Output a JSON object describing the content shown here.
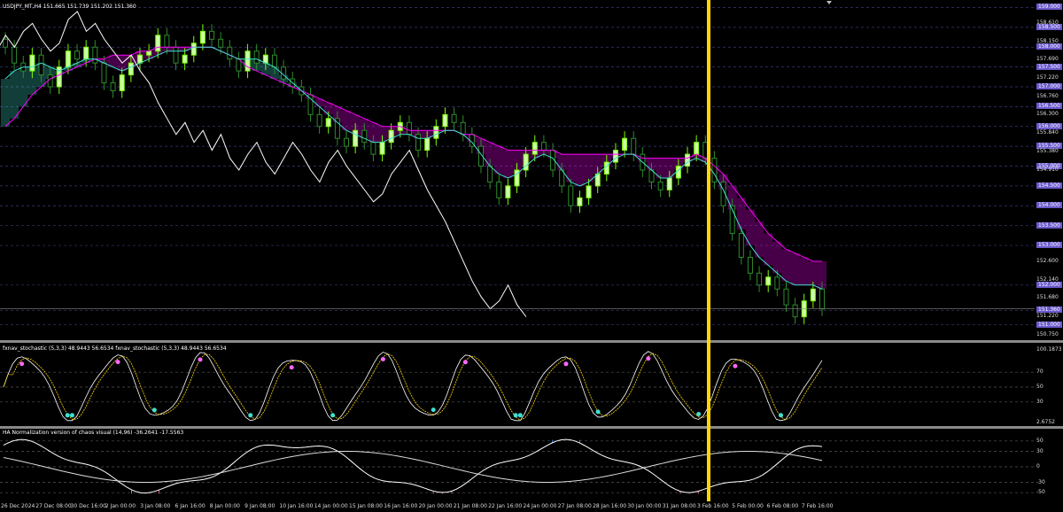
{
  "main": {
    "header": "USDJPY_MT,H4  151.665 151.739 151.202 151.360",
    "price_axis": [
      {
        "text": "159.000",
        "boxed": true
      },
      {
        "text": "158.610",
        "boxed": false
      },
      {
        "text": "158.500",
        "boxed": true
      },
      {
        "text": "158.150",
        "boxed": false
      },
      {
        "text": "158.000",
        "boxed": true
      },
      {
        "text": "157.690",
        "boxed": false
      },
      {
        "text": "157.500",
        "boxed": true
      },
      {
        "text": "157.220",
        "boxed": false
      },
      {
        "text": "157.000",
        "boxed": true
      },
      {
        "text": "156.760",
        "boxed": false
      },
      {
        "text": "156.500",
        "boxed": true
      },
      {
        "text": "156.300",
        "boxed": false
      },
      {
        "text": "156.000",
        "boxed": true
      },
      {
        "text": "155.840",
        "boxed": false
      },
      {
        "text": "155.500",
        "boxed": true
      },
      {
        "text": "155.380",
        "boxed": false
      },
      {
        "text": "155.000",
        "boxed": true
      },
      {
        "text": "154.910",
        "boxed": false
      },
      {
        "text": "154.500",
        "boxed": true
      },
      {
        "text": "154.000",
        "boxed": true
      },
      {
        "text": "153.500",
        "boxed": true
      },
      {
        "text": "153.000",
        "boxed": true
      },
      {
        "text": "152.600",
        "boxed": false
      },
      {
        "text": "152.140",
        "boxed": false
      },
      {
        "text": "152.000",
        "boxed": true
      },
      {
        "text": "151.680",
        "boxed": false
      },
      {
        "text": "151.360",
        "boxed": true
      },
      {
        "text": "151.220",
        "boxed": false
      },
      {
        "text": "151.000",
        "boxed": true
      },
      {
        "text": "150.750",
        "boxed": false
      }
    ]
  },
  "stoch": {
    "header": "fxnav_stochastic (5,3,3) 48.9443 56.6534  fxnav_stochastic (5,3,3) 48.9443 56.6534",
    "axis": [
      "100.1873",
      "70",
      "50",
      "30",
      "2.6752"
    ]
  },
  "osc": {
    "header": "HA Normalization version of chaos visual (14,96) -36.2641 -17.5563",
    "axis": [
      "50",
      "30",
      "0",
      "-30",
      "-50"
    ]
  },
  "time_axis": [
    "26 Dec 2024",
    "27 Dec 08:00",
    "30 Dec 16:00",
    "2 Jan 00:00",
    "3 Jan 08:00",
    "6 Jan 16:00",
    "8 Jan 00:00",
    "9 Jan 08:00",
    "10 Jan 16:00",
    "14 Jan 00:00",
    "15 Jan 08:00",
    "16 Jan 16:00",
    "20 Jan 00:00",
    "21 Jan 08:00",
    "22 Jan 16:00",
    "24 Jan 00:00",
    "27 Jan 08:00",
    "28 Jan 16:00",
    "30 Jan 00:00",
    "31 Jan 08:00",
    "3 Feb 16:00",
    "5 Feb 00:00",
    "6 Feb 08:00",
    "7 Feb 16:00"
  ],
  "colors": {
    "bull": "#7CFC00",
    "bear": "#2e8b2e",
    "kumo_bull": "#40e0d0",
    "kumo_bear": "#ff00ff",
    "kijun": "#ff00ff",
    "tenkan": "#40e0d0",
    "chikou": "#ffffff",
    "vline": "#ffd700",
    "stoch_main": "#ffffff",
    "stoch_signal": "#ffd700",
    "osc_pos": "#1e90ff",
    "osc_neg": "#ff69b4"
  },
  "series": {
    "close": [
      158.0,
      157.6,
      157.4,
      157.8,
      157.3,
      157.0,
      157.5,
      157.9,
      157.7,
      158.0,
      157.6,
      157.1,
      156.9,
      157.3,
      157.6,
      157.8,
      157.9,
      158.3,
      158.0,
      157.6,
      157.8,
      158.1,
      158.4,
      158.2,
      158.0,
      157.7,
      157.4,
      157.9,
      157.6,
      157.8,
      157.5,
      157.2,
      157.0,
      156.8,
      156.3,
      156.0,
      156.2,
      155.7,
      155.5,
      155.9,
      155.6,
      155.3,
      155.6,
      155.9,
      156.1,
      155.8,
      155.4,
      155.7,
      156.0,
      156.3,
      156.1,
      155.8,
      155.5,
      155.0,
      154.6,
      154.2,
      154.5,
      154.9,
      155.3,
      155.6,
      155.4,
      154.9,
      154.5,
      154.0,
      154.2,
      154.5,
      154.8,
      155.1,
      155.4,
      155.7,
      155.3,
      154.9,
      154.6,
      154.4,
      154.7,
      155.0,
      155.3,
      155.6,
      155.2,
      154.6,
      154.0,
      153.3,
      152.7,
      152.3,
      152.0,
      152.2,
      151.9,
      151.5,
      151.2,
      151.6,
      151.9,
      151.4
    ],
    "tenkan": [
      157.2,
      157.4,
      157.5,
      157.5,
      157.6,
      157.5,
      157.4,
      157.5,
      157.6,
      157.7,
      157.7,
      157.6,
      157.5,
      157.4,
      157.5,
      157.6,
      157.7,
      157.8,
      157.9,
      157.9,
      157.9,
      158.0,
      158.0,
      158.0,
      157.9,
      157.8,
      157.7,
      157.7,
      157.7,
      157.6,
      157.5,
      157.3,
      157.1,
      156.9,
      156.7,
      156.5,
      156.3,
      156.1,
      155.9,
      155.8,
      155.7,
      155.6,
      155.6,
      155.7,
      155.8,
      155.8,
      155.7,
      155.7,
      155.8,
      155.9,
      155.9,
      155.8,
      155.6,
      155.3,
      155.0,
      154.8,
      154.7,
      154.8,
      155.0,
      155.2,
      155.3,
      155.2,
      154.9,
      154.6,
      154.5,
      154.6,
      154.8,
      155.0,
      155.2,
      155.3,
      155.3,
      155.1,
      154.9,
      154.7,
      154.7,
      154.9,
      155.1,
      155.2,
      155.1,
      154.8,
      154.4,
      153.9,
      153.4,
      153.0,
      152.7,
      152.5,
      152.3,
      152.1,
      152.0,
      152.0,
      152.0,
      151.9
    ],
    "kijun": [
      156.0,
      156.2,
      156.5,
      156.8,
      157.0,
      157.2,
      157.3,
      157.4,
      157.5,
      157.6,
      157.7,
      157.7,
      157.8,
      157.8,
      157.8,
      157.9,
      157.9,
      158.0,
      158.0,
      158.0,
      158.0,
      158.0,
      158.0,
      158.0,
      157.9,
      157.8,
      157.7,
      157.5,
      157.4,
      157.3,
      157.2,
      157.1,
      157.0,
      156.9,
      156.8,
      156.7,
      156.6,
      156.5,
      156.4,
      156.3,
      156.2,
      156.1,
      156.0,
      156.0,
      156.0,
      155.9,
      155.9,
      155.9,
      155.9,
      155.9,
      155.9,
      155.8,
      155.8,
      155.7,
      155.6,
      155.5,
      155.4,
      155.4,
      155.4,
      155.4,
      155.4,
      155.4,
      155.3,
      155.3,
      155.3,
      155.3,
      155.3,
      155.3,
      155.3,
      155.3,
      155.3,
      155.2,
      155.2,
      155.2,
      155.2,
      155.2,
      155.2,
      155.3,
      155.2,
      155.0,
      154.8,
      154.5,
      154.2,
      153.9,
      153.6,
      153.3,
      153.1,
      152.9,
      152.8,
      152.7,
      152.6,
      152.6
    ],
    "chikou": [
      158.1,
      157.9,
      158.3,
      158.0,
      158.4,
      158.6,
      158.2,
      157.9,
      158.1,
      158.7,
      158.9,
      158.4,
      158.6,
      158.2,
      157.9,
      157.6,
      157.8,
      157.4,
      157.1,
      156.6,
      156.2,
      155.8,
      156.1,
      155.6,
      155.9,
      155.4,
      155.8,
      155.2,
      154.9,
      155.3,
      155.6,
      155.1,
      154.8,
      155.2,
      155.6,
      155.3,
      154.9,
      154.6,
      155.1,
      155.4,
      155.0,
      154.7,
      154.4,
      154.1,
      154.3,
      154.8,
      155.1,
      155.4,
      154.9,
      154.4,
      154.0,
      153.6,
      153.1,
      152.6,
      152.1,
      151.7,
      151.4,
      151.6,
      152.0,
      151.5,
      151.2
    ]
  }
}
